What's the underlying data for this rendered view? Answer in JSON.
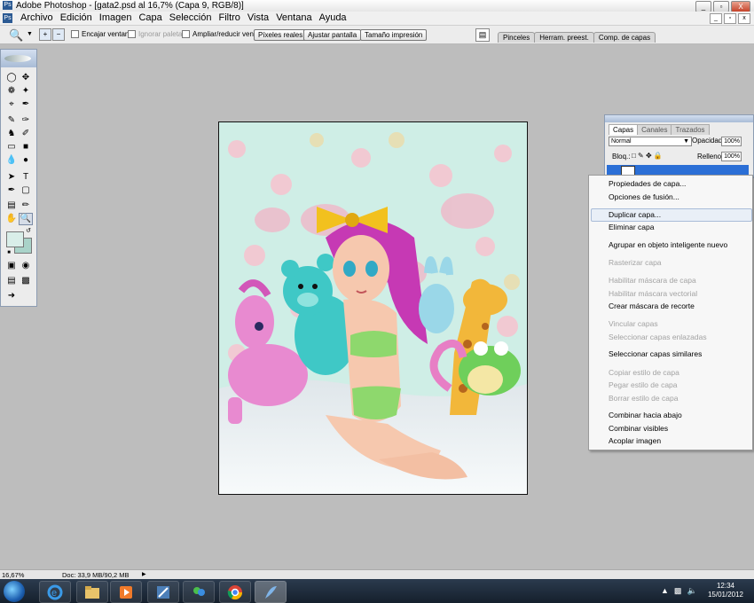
{
  "window": {
    "title": "Adobe Photoshop - [gata2.psd al 16,7% (Capa 9, RGB/8)]",
    "app_logo": "Ps",
    "controls": [
      "_",
      "▫",
      "X"
    ],
    "doc_controls": [
      "_",
      "▫",
      "x"
    ]
  },
  "menu": [
    "Archivo",
    "Edición",
    "Imagen",
    "Capa",
    "Selección",
    "Filtro",
    "Vista",
    "Ventana",
    "Ayuda"
  ],
  "options_bar": {
    "tool_icon": "zoom-icon",
    "checkboxes": [
      {
        "label": "Encajar ventana",
        "enabled": true
      },
      {
        "label": "Ignorar paletas",
        "enabled": false
      },
      {
        "label": "Ampliar/reducir vent.",
        "enabled": true
      }
    ],
    "buttons": [
      "Píxeles reales",
      "Ajustar pantalla",
      "Tamaño impresión"
    ],
    "palette_well_tabs": [
      "Pinceles",
      "Herram. preest.",
      "Comp. de capas"
    ]
  },
  "toolbox": {
    "tools": [
      "marquee-icon",
      "move-icon",
      "lasso-icon",
      "magic-wand-icon",
      "crop-icon",
      "slice-icon",
      "healing-brush-icon",
      "brush-icon",
      "clone-stamp-icon",
      "history-brush-icon",
      "eraser-icon",
      "gradient-icon",
      "blur-icon",
      "dodge-icon",
      "path-selection-icon",
      "type-icon",
      "pen-icon",
      "shape-icon",
      "notes-icon",
      "eyedropper-icon",
      "hand-icon",
      "zoom-icon"
    ],
    "active_tool": "zoom-icon",
    "foreground_color": "#d9eee9",
    "background_color": "#a9d3c9"
  },
  "layers_palette": {
    "tabs": [
      "Capas",
      "Canales",
      "Trazados"
    ],
    "active_tab": "Capas",
    "blend_mode": "Normal",
    "opacity_label": "Opacidad:",
    "opacity": "100%",
    "lock_label": "Bloq.:",
    "fill_label": "Relleno:",
    "fill": "100%"
  },
  "context_menu": {
    "items": [
      {
        "label": "Propiedades de capa...",
        "enabled": true
      },
      {
        "label": "Opciones de fusión...",
        "enabled": true
      },
      {
        "label": "Duplicar capa...",
        "enabled": true,
        "highlighted": true
      },
      {
        "label": "Eliminar capa",
        "enabled": true
      },
      {
        "label": "Agrupar en objeto inteligente nuevo",
        "enabled": true
      },
      {
        "label": "Rasterizar capa",
        "enabled": false
      },
      {
        "label": "Habilitar máscara de capa",
        "enabled": false
      },
      {
        "label": "Habilitar máscara vectorial",
        "enabled": false
      },
      {
        "label": "Crear máscara de recorte",
        "enabled": true
      },
      {
        "label": "Vincular capas",
        "enabled": false
      },
      {
        "label": "Seleccionar capas enlazadas",
        "enabled": false
      },
      {
        "label": "Seleccionar capas similares",
        "enabled": true
      },
      {
        "label": "Copiar estilo de capa",
        "enabled": false
      },
      {
        "label": "Pegar estilo de capa",
        "enabled": false
      },
      {
        "label": "Borrar estilo de capa",
        "enabled": false
      },
      {
        "label": "Combinar hacia abajo",
        "enabled": true
      },
      {
        "label": "Combinar visibles",
        "enabled": true
      },
      {
        "label": "Acoplar imagen",
        "enabled": true
      }
    ]
  },
  "status_bar": {
    "zoom": "16,67%",
    "doc_info": "Doc: 33,9 MB/90,2 MB"
  },
  "taskbar": {
    "apps": [
      "internet-explorer-icon",
      "explorer-icon",
      "media-player-icon",
      "photoshop-icon",
      "messenger-icon",
      "chrome-icon",
      "feather-app-icon"
    ],
    "time": "12:34",
    "date": "15/01/2012"
  },
  "colors": {
    "canvas_bg": "#bdbdbd",
    "menu_highlight": "#e9eff7",
    "selected_layer": "#2b6fd6",
    "artwork_bg": "#cfeee6"
  }
}
